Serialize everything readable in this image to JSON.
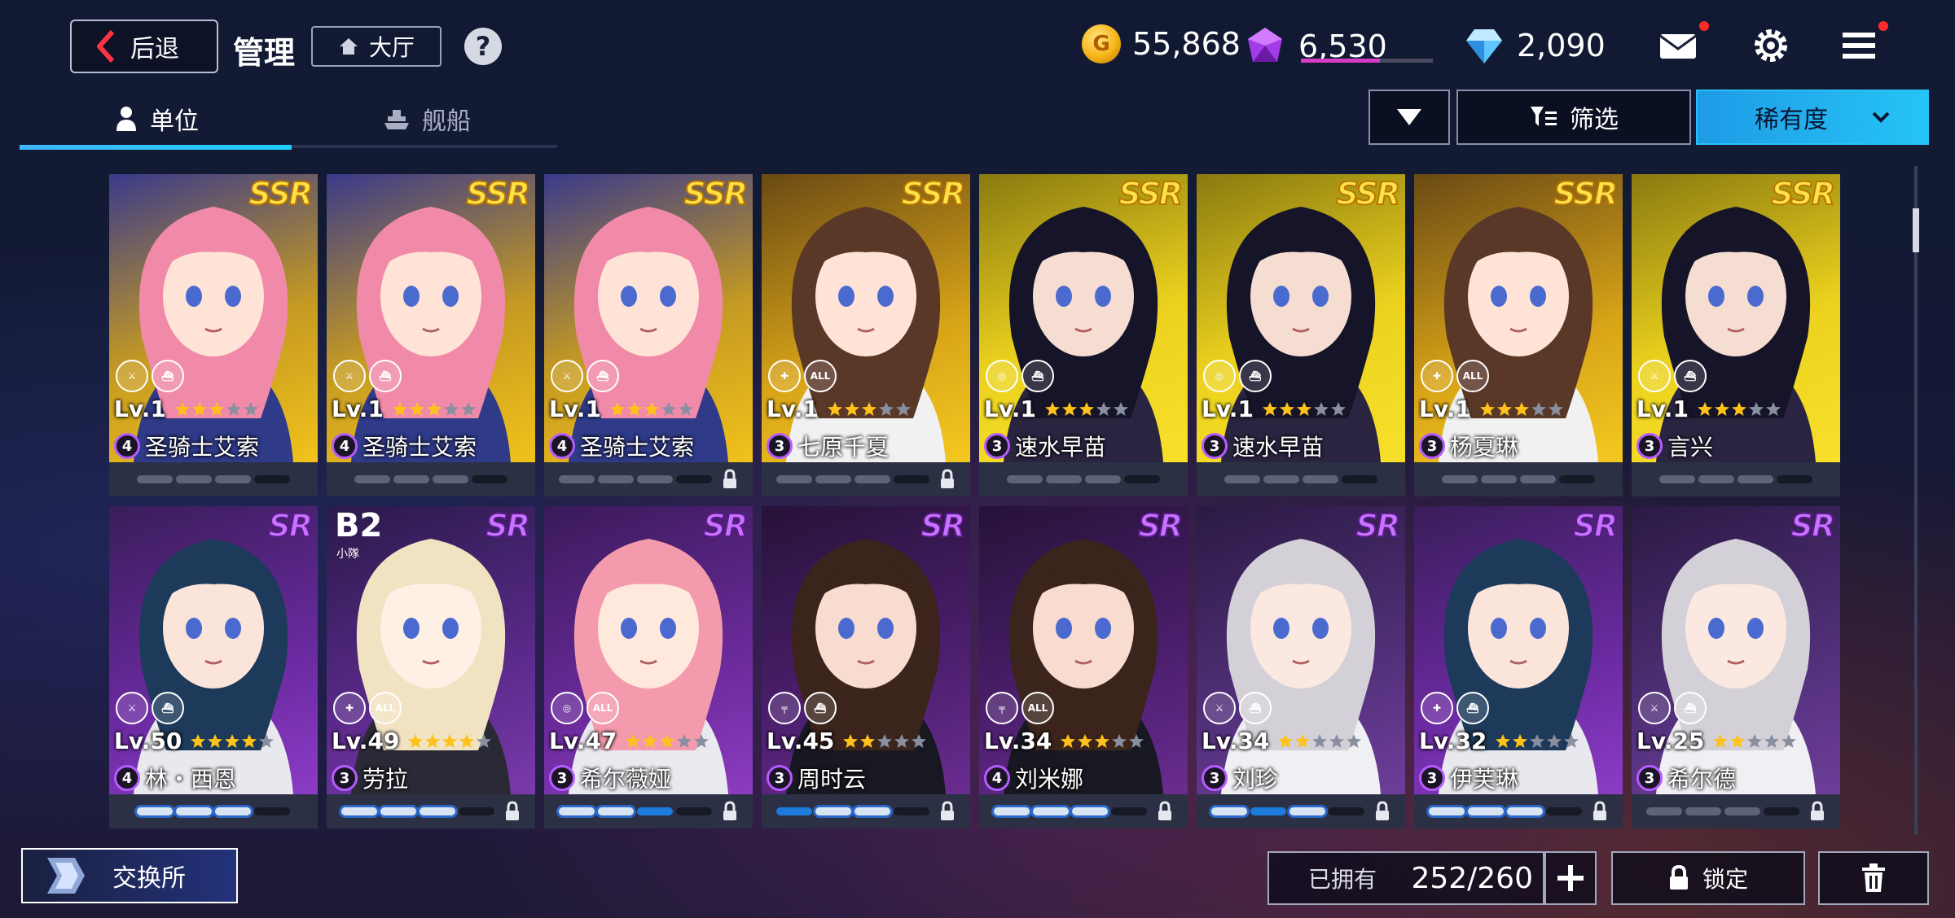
{
  "header": {
    "back_label": "后退",
    "title": "管理",
    "lobby_label": "大厅",
    "help_label": "?",
    "currencies": [
      {
        "icon": "gold-coin-icon",
        "value": "55,868"
      },
      {
        "icon": "purple-crystal-icon",
        "value": "6,530"
      },
      {
        "icon": "blue-diamond-icon",
        "value": "2,090"
      }
    ],
    "purple_progress": 0.6
  },
  "tabs": [
    {
      "label": "单位",
      "icon": "person-icon",
      "active": true
    },
    {
      "label": "舰船",
      "icon": "ship-icon",
      "active": false
    }
  ],
  "sort": {
    "filter_label": "筛选",
    "rarity_label": "稀有度"
  },
  "units": [
    {
      "rarity": "SSR",
      "level": "Lv.1",
      "stars": 3,
      "rank": "4",
      "name": "圣骑士艾索",
      "skills": [
        "swords",
        "ship"
      ],
      "pips": [
        "g",
        "g",
        "g",
        "d"
      ],
      "locked": false,
      "bg": "ssr-pink"
    },
    {
      "rarity": "SSR",
      "level": "Lv.1",
      "stars": 3,
      "rank": "4",
      "name": "圣骑士艾索",
      "skills": [
        "swords",
        "ship"
      ],
      "pips": [
        "g",
        "g",
        "g",
        "d"
      ],
      "locked": false,
      "bg": "ssr-pink"
    },
    {
      "rarity": "SSR",
      "level": "Lv.1",
      "stars": 3,
      "rank": "4",
      "name": "圣骑士艾索",
      "skills": [
        "swords",
        "ship"
      ],
      "pips": [
        "g",
        "g",
        "g",
        "d"
      ],
      "locked": true,
      "bg": "ssr-pink"
    },
    {
      "rarity": "SSR",
      "level": "Lv.1",
      "stars": 3,
      "rank": "3",
      "name": "七原千夏",
      "skills": [
        "heal",
        "ALL"
      ],
      "pips": [
        "g",
        "g",
        "g",
        "d"
      ],
      "locked": true,
      "bg": "ssr-brown"
    },
    {
      "rarity": "SSR",
      "level": "Lv.1",
      "stars": 3,
      "rank": "3",
      "name": "速水早苗",
      "skills": [
        "target",
        "ship"
      ],
      "pips": [
        "g",
        "g",
        "g",
        "d"
      ],
      "locked": false,
      "bg": "ssr-dark"
    },
    {
      "rarity": "SSR",
      "level": "Lv.1",
      "stars": 3,
      "rank": "3",
      "name": "速水早苗",
      "skills": [
        "target",
        "ship"
      ],
      "pips": [
        "g",
        "g",
        "g",
        "d"
      ],
      "locked": false,
      "bg": "ssr-dark"
    },
    {
      "rarity": "SSR",
      "level": "Lv.1",
      "stars": 3,
      "rank": "3",
      "name": "杨夏琳",
      "skills": [
        "heal",
        "ALL"
      ],
      "pips": [
        "g",
        "g",
        "g",
        "d"
      ],
      "locked": false,
      "bg": "ssr-brown"
    },
    {
      "rarity": "SSR",
      "level": "Lv.1",
      "stars": 3,
      "rank": "3",
      "name": "言兴",
      "skills": [
        "swords",
        "ship"
      ],
      "pips": [
        "g",
        "g",
        "g",
        "d"
      ],
      "locked": false,
      "bg": "ssr-dark"
    },
    {
      "rarity": "SR",
      "level": "Lv.50",
      "stars": 4,
      "rank": "4",
      "name": "林・西恩",
      "skills": [
        "swords",
        "ship"
      ],
      "pips": [
        "on",
        "on",
        "w",
        "d"
      ],
      "locked": false,
      "bg": "sr-teal",
      "badge": ""
    },
    {
      "rarity": "SR",
      "level": "Lv.49",
      "stars": 4,
      "rank": "3",
      "name": "劳拉",
      "skills": [
        "heal",
        "ALL"
      ],
      "pips": [
        "on",
        "w",
        "on",
        "d"
      ],
      "locked": true,
      "bg": "sr-blonde",
      "badge": "B2",
      "badge_sub": "小隊"
    },
    {
      "rarity": "SR",
      "level": "Lv.47",
      "stars": 3,
      "rank": "3",
      "name": "希尔薇娅",
      "skills": [
        "target",
        "ALL"
      ],
      "pips": [
        "w",
        "w",
        "b",
        "d"
      ],
      "locked": true,
      "bg": "sr-pink"
    },
    {
      "rarity": "SR",
      "level": "Lv.45",
      "stars": 2,
      "rank": "3",
      "name": "周时云",
      "skills": [
        "gun",
        "ship"
      ],
      "pips": [
        "b",
        "on",
        "on",
        "d"
      ],
      "locked": true,
      "bg": "sr-brown"
    },
    {
      "rarity": "SR",
      "level": "Lv.34",
      "stars": 3,
      "rank": "4",
      "name": "刘米娜",
      "skills": [
        "gun",
        "ALL"
      ],
      "pips": [
        "w",
        "w",
        "w",
        "d"
      ],
      "locked": true,
      "bg": "sr-brown"
    },
    {
      "rarity": "SR",
      "level": "Lv.34",
      "stars": 2,
      "rank": "3",
      "name": "刘珍",
      "skills": [
        "swords",
        "ship"
      ],
      "pips": [
        "on",
        "b",
        "on",
        "d"
      ],
      "locked": true,
      "bg": "sr-silver"
    },
    {
      "rarity": "SR",
      "level": "Lv.32",
      "stars": 2,
      "rank": "3",
      "name": "伊芙琳",
      "skills": [
        "heal",
        "ship"
      ],
      "pips": [
        "w",
        "on",
        "on",
        "d"
      ],
      "locked": true,
      "bg": "sr-teal"
    },
    {
      "rarity": "SR",
      "level": "Lv.25",
      "stars": 2,
      "rank": "3",
      "name": "希尔德",
      "skills": [
        "swords",
        "ship"
      ],
      "pips": [
        "g",
        "g",
        "g",
        "d"
      ],
      "locked": true,
      "bg": "sr-silver"
    }
  ],
  "footer": {
    "exchange_label": "交换所",
    "owned_label": "已拥有",
    "owned_count": "252/260",
    "lock_label": "锁定"
  },
  "colors": {
    "accent_blue": "#26c4f6",
    "ssr_gold": "#ffe24a",
    "sr_purple": "#c873ff",
    "rank_ring": "#b65cff"
  }
}
